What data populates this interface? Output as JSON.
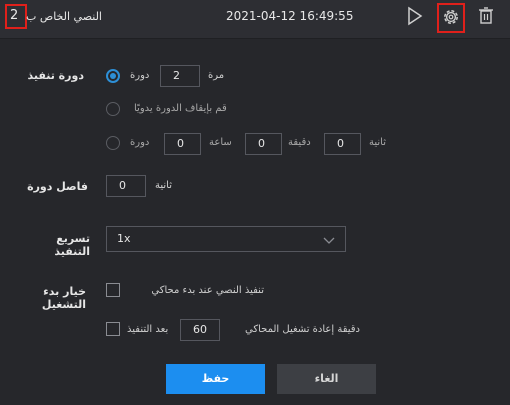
{
  "header": {
    "badge_number": "2",
    "title": "النصي الخاص ب",
    "timestamp": "2021-04-12 16:49:55"
  },
  "icons": {
    "play": "play-icon",
    "settings": "gear-icon",
    "delete": "trash-icon"
  },
  "execution_cycle": {
    "label": "دورة تنفيذ",
    "option_count": {
      "value": "2",
      "unit": "مرة",
      "suffix": "دورة",
      "selected": true
    },
    "option_manual": {
      "text": "قم بإيقاف الدورة يدويًا",
      "selected": false
    },
    "option_time": {
      "selected": false,
      "hours": "0",
      "hours_label": "ساعة",
      "minutes": "0",
      "minutes_label": "دقيقة",
      "seconds": "0",
      "seconds_label": "ثانية",
      "suffix": "دورة"
    }
  },
  "cycle_interval": {
    "label": "فاصل دورة",
    "value": "0",
    "unit": "ثانية"
  },
  "speed": {
    "label": "تسريع التنفيذ",
    "selected": "1x"
  },
  "startup": {
    "label": "خيار بدء التشغيل",
    "option1": {
      "text": "تنفيذ النصي عند بدء محاكي",
      "checked": false
    },
    "option2": {
      "checked": false,
      "text_before": "دقيقة إعادة تشغيل المحاكي",
      "value": "60",
      "text_after": "بعد التنفيذ"
    }
  },
  "buttons": {
    "save": "حفظ",
    "cancel": "الغاء"
  },
  "colors": {
    "accent": "#1c8ef0",
    "highlight": "#e0201b",
    "background": "#26272b"
  }
}
